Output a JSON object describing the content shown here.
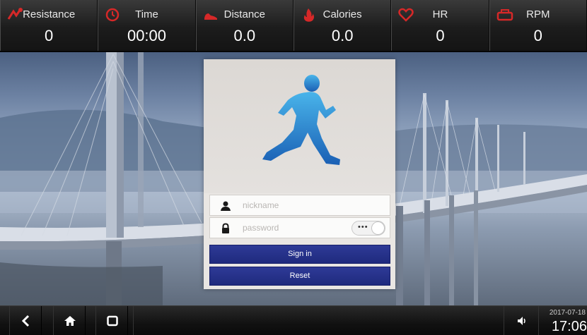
{
  "metrics": [
    {
      "label": "Resistance",
      "value": "0",
      "icon": "resistance-icon"
    },
    {
      "label": "Time",
      "value": "00:00",
      "icon": "clock-icon"
    },
    {
      "label": "Distance",
      "value": "0.0",
      "icon": "shoe-icon"
    },
    {
      "label": "Calories",
      "value": "0.0",
      "icon": "flame-icon"
    },
    {
      "label": "HR",
      "value": "0",
      "icon": "heart-icon"
    },
    {
      "label": "RPM",
      "value": "0",
      "icon": "pedal-icon"
    }
  ],
  "login": {
    "hero_icon": "runner-icon",
    "username_placeholder": "nickname",
    "password_placeholder": "password",
    "password_toggle": "•••",
    "signin_label": "Sign in",
    "reset_label": "Reset"
  },
  "navbar": {
    "back_icon": "back-icon",
    "home_icon": "home-icon",
    "recent_icon": "recent-apps-icon",
    "volume_icon": "volume-icon",
    "date": "2017-07-18",
    "time": "17:06"
  },
  "colors": {
    "metric_icon": "#d62828",
    "button": "#222c86",
    "runner": "#1f86d1"
  }
}
